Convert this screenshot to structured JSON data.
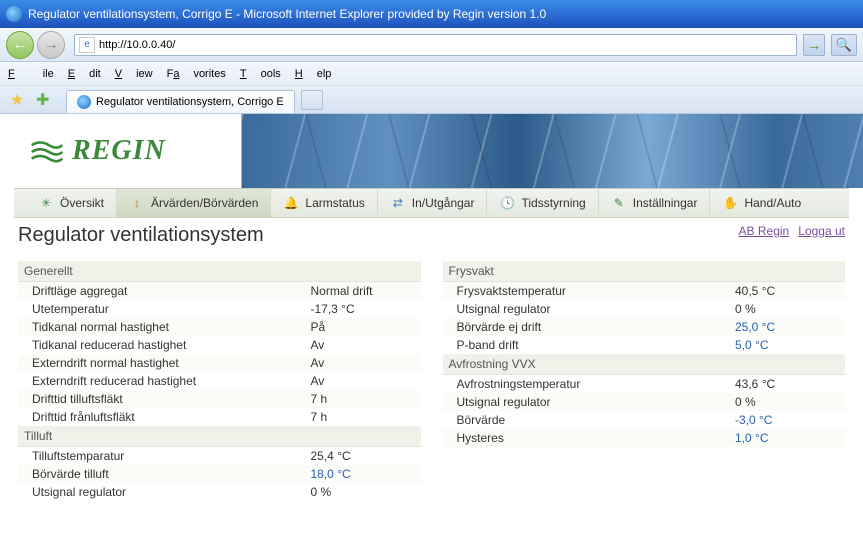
{
  "window": {
    "title": "Regulator ventilationsystem, Corrigo E - Microsoft Internet Explorer provided by Regin version 1.0"
  },
  "address": {
    "url": "http://10.0.0.40/"
  },
  "menu": {
    "file": "File",
    "edit": "Edit",
    "view": "View",
    "favorites": "Favorites",
    "tools": "Tools",
    "help": "Help"
  },
  "tab": {
    "label": "Regulator ventilationsystem, Corrigo E"
  },
  "logo": {
    "text": "REGIN"
  },
  "nav": {
    "items": [
      {
        "label": "Översikt",
        "icon": "overview"
      },
      {
        "label": "Ärvärden/Börvärden",
        "icon": "values"
      },
      {
        "label": "Larmstatus",
        "icon": "alarm"
      },
      {
        "label": "In/Utgångar",
        "icon": "io"
      },
      {
        "label": "Tidsstyrning",
        "icon": "time"
      },
      {
        "label": "Inställningar",
        "icon": "settings"
      },
      {
        "label": "Hand/Auto",
        "icon": "handauto"
      }
    ]
  },
  "page": {
    "title": "Regulator ventilationsystem",
    "links": {
      "ab_regin": "AB Regin",
      "logout": "Logga ut"
    }
  },
  "left": {
    "sect1": {
      "title": "Generellt",
      "rows": [
        {
          "label": "Driftläge aggregat",
          "val": "Normal drift",
          "editable": false
        },
        {
          "label": "Utetemperatur",
          "val": "-17,3 °C",
          "editable": false
        },
        {
          "label": "Tidkanal normal hastighet",
          "val": "På",
          "editable": false
        },
        {
          "label": "Tidkanal reducerad hastighet",
          "val": "Av",
          "editable": false
        },
        {
          "label": "Externdrift normal hastighet",
          "val": "Av",
          "editable": false
        },
        {
          "label": "Externdrift reducerad hastighet",
          "val": "Av",
          "editable": false
        },
        {
          "label": "Drifttid tilluftsfläkt",
          "val": "7 h",
          "editable": false
        },
        {
          "label": "Drifttid frånluftsfläkt",
          "val": "7 h",
          "editable": false
        }
      ]
    },
    "sect2": {
      "title": "Tilluft",
      "rows": [
        {
          "label": "Tilluftstemparatur",
          "val": "25,4 °C",
          "editable": false
        },
        {
          "label": "Börvärde tilluft",
          "val": "18,0 °C",
          "editable": true
        },
        {
          "label": "Utsignal regulator",
          "val": "0 %",
          "editable": false
        }
      ]
    }
  },
  "right": {
    "sect1": {
      "title": "Frysvakt",
      "rows": [
        {
          "label": "Frysvaktstemperatur",
          "val": "40,5 °C",
          "editable": false
        },
        {
          "label": "Utsignal regulator",
          "val": "0 %",
          "editable": false
        },
        {
          "label": "Börvärde ej drift",
          "val": "25,0 °C",
          "editable": true
        },
        {
          "label": "P-band drift",
          "val": "5,0 °C",
          "editable": true
        }
      ]
    },
    "sect2": {
      "title": "Avfrostning VVX",
      "rows": [
        {
          "label": "Avfrostningstemperatur",
          "val": "43,6 °C",
          "editable": false
        },
        {
          "label": "Utsignal regulator",
          "val": "0 %",
          "editable": false
        },
        {
          "label": "Börvärde",
          "val": "-3,0 °C",
          "editable": true
        },
        {
          "label": "Hysteres",
          "val": "1,0 °C",
          "editable": true
        }
      ]
    }
  }
}
